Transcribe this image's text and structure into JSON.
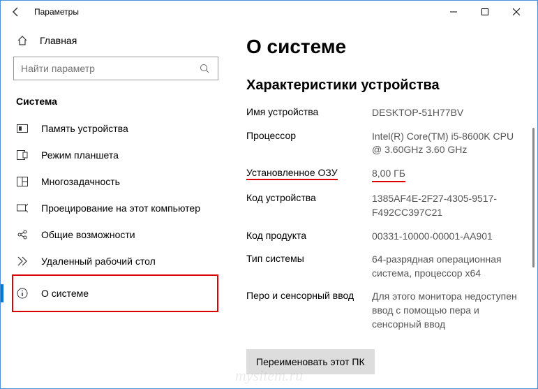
{
  "window": {
    "title": "Параметры"
  },
  "sidebar": {
    "home": "Главная",
    "search_placeholder": "Найти параметр",
    "section": "Система",
    "items": [
      {
        "label": "Память устройства"
      },
      {
        "label": "Режим планшета"
      },
      {
        "label": "Многозадачность"
      },
      {
        "label": "Проецирование на этот компьютер"
      },
      {
        "label": "Общие возможности"
      },
      {
        "label": "Удаленный рабочий стол"
      },
      {
        "label": "О системе"
      }
    ]
  },
  "content": {
    "heading": "О системе",
    "subheading": "Характеристики устройства",
    "specs": {
      "device_name_label": "Имя устройства",
      "device_name_value": "DESKTOP-51H77BV",
      "processor_label": "Процессор",
      "processor_value": "Intel(R) Core(TM) i5-8600K CPU @ 3.60GHz   3.60 GHz",
      "ram_label": "Установленное ОЗУ",
      "ram_value": "8,00 ГБ",
      "device_id_label": "Код устройства",
      "device_id_value": "1385AF4E-2F27-4305-9517-F492CC397C21",
      "product_id_label": "Код продукта",
      "product_id_value": "00331-10000-00001-AA901",
      "system_type_label": "Тип системы",
      "system_type_value": "64-разрядная операционная система, процессор x64",
      "pen_label": "Перо и сенсорный ввод",
      "pen_value": "Для этого монитора недоступен ввод с помощью пера и сенсорный ввод"
    },
    "rename_button": "Переименовать этот ПК"
  },
  "watermark": "mysitem.ru"
}
